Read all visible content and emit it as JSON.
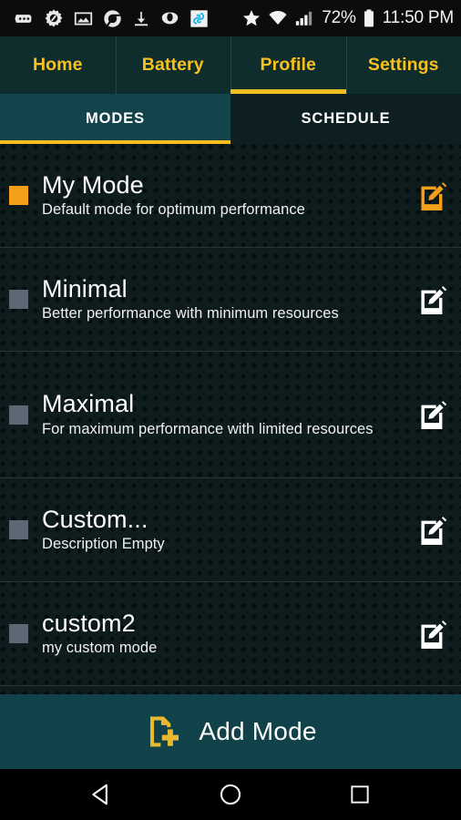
{
  "statusbar": {
    "left_icons": [
      "messaging-icon",
      "settings-gear-icon",
      "gallery-image-icon",
      "chrome-icon",
      "download-icon",
      "opera-icon",
      "app-icon"
    ],
    "star_icon": "star-icon",
    "wifi_icon": "wifi-icon",
    "signal_icon": "cellular-signal-icon",
    "battery_percent": "72%",
    "battery_icon": "battery-icon",
    "clock": "11:50 PM"
  },
  "top_tabs": {
    "items": [
      {
        "label": "Home",
        "active": false
      },
      {
        "label": "Battery",
        "active": false
      },
      {
        "label": "Profile",
        "active": true
      },
      {
        "label": "Settings",
        "active": false
      }
    ],
    "accent_color": "#f4bf1e",
    "background_color": "#0f2d2c"
  },
  "sub_tabs": {
    "items": [
      {
        "label": "MODES",
        "active": true
      },
      {
        "label": "SCHEDULE",
        "active": false
      }
    ],
    "active_background": "#13444b",
    "indicator_color": "#f4bf1e"
  },
  "modes": {
    "selected_color": "#f59f1b",
    "unselected_color": "#5c6974",
    "items": [
      {
        "title": "My Mode",
        "description": "Default mode for optimum performance",
        "selected": true,
        "edit_icon": "edit-pencil-icon"
      },
      {
        "title": "Minimal",
        "description": "Better performance with minimum resources",
        "selected": false,
        "edit_icon": "edit-pencil-icon"
      },
      {
        "title": "Maximal",
        "description": "For maximum performance with limited resources",
        "selected": false,
        "edit_icon": "edit-pencil-icon"
      },
      {
        "title": "Custom...",
        "description": "Description Empty",
        "selected": false,
        "edit_icon": "edit-pencil-icon"
      },
      {
        "title": "custom2",
        "description": "my custom mode",
        "selected": false,
        "edit_icon": "edit-pencil-icon"
      }
    ]
  },
  "add_mode": {
    "label": "Add Mode",
    "icon": "document-plus-icon",
    "icon_color": "#e8b930",
    "background_color": "#114249"
  },
  "navbar": {
    "back": "back-triangle-icon",
    "home": "home-circle-icon",
    "recents": "recents-square-icon"
  }
}
